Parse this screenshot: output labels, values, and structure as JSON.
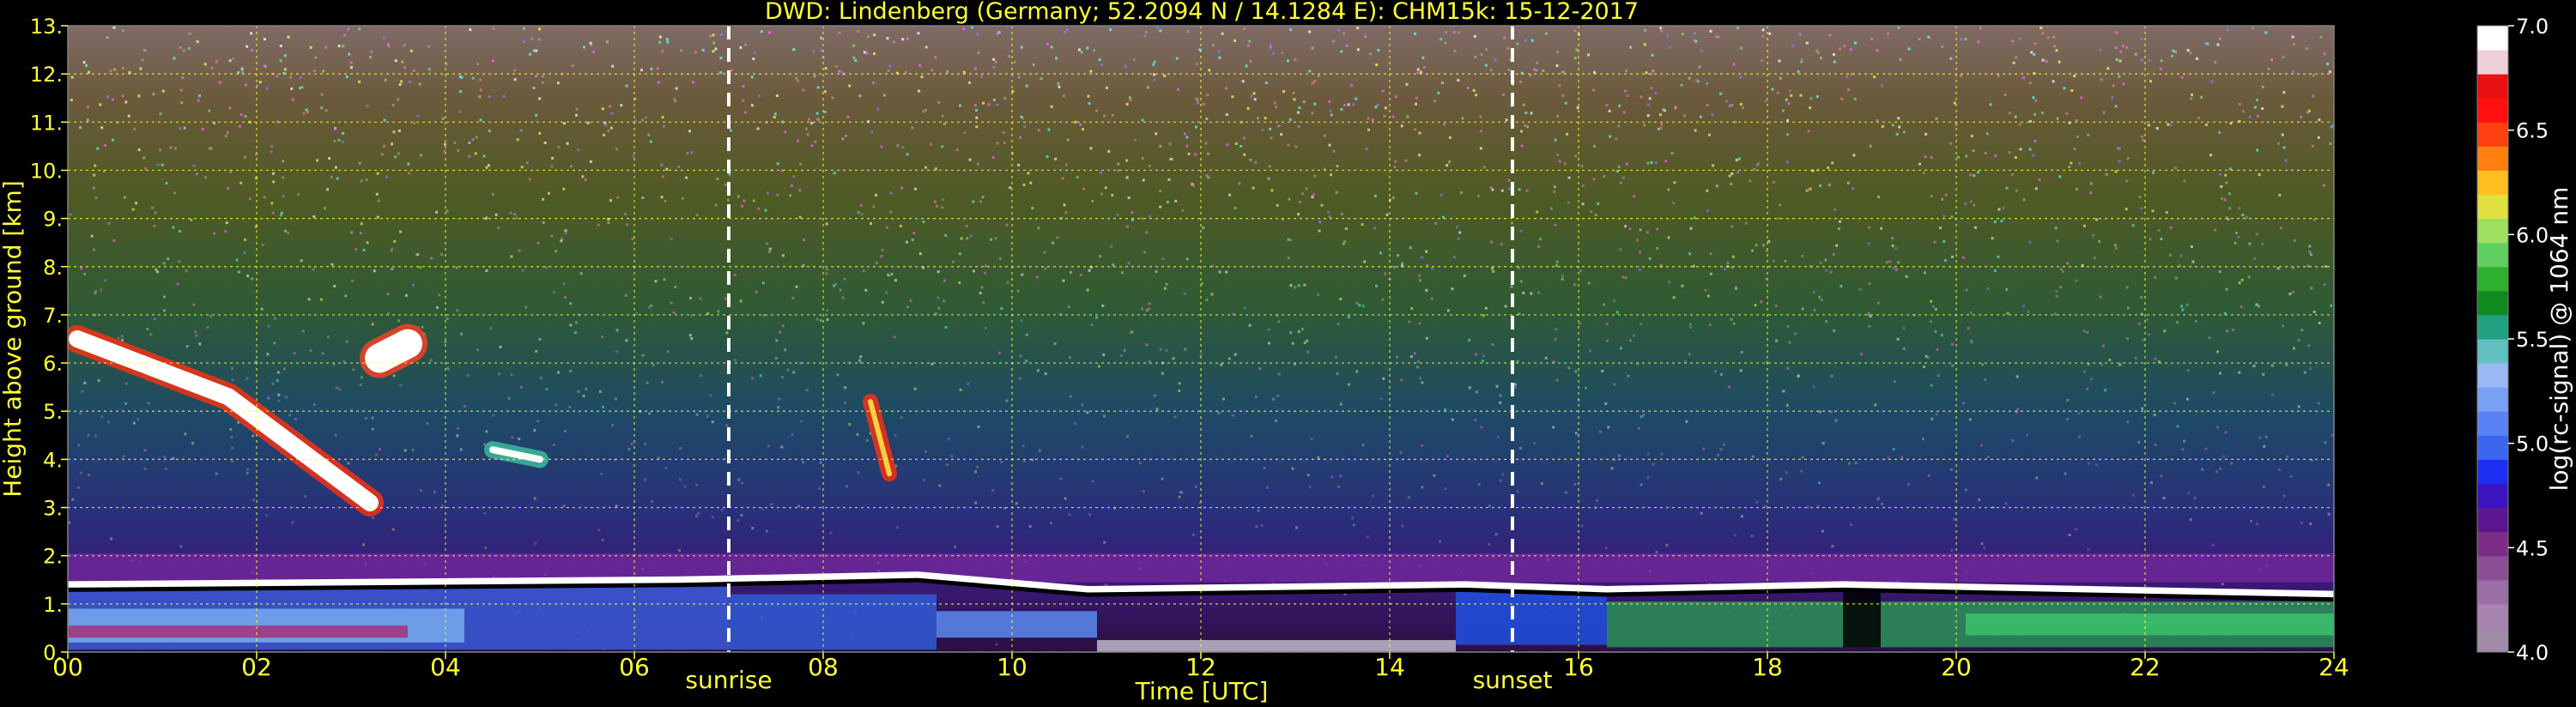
{
  "chart_data": {
    "type": "heatmap",
    "title": "DWD: Lindenberg (Germany; 52.2094 N / 14.1284 E):    CHM15k: 15-12-2017",
    "xlabel": "Time [UTC]",
    "ylabel": "Height above ground [km]",
    "xlim": [
      0,
      24
    ],
    "ylim": [
      0,
      13
    ],
    "x_ticks": [
      "00",
      "02",
      "04",
      "06",
      "08",
      "10",
      "12",
      "14",
      "16",
      "18",
      "20",
      "22",
      "24"
    ],
    "y_ticks": [
      "0.",
      "1.",
      "2.",
      "3.",
      "4.",
      "5.",
      "6.",
      "7.",
      "8.",
      "9.",
      "10.",
      "11.",
      "12.",
      "13."
    ],
    "grid": true,
    "colorbar": {
      "label": "log(rc-signal) @ 1064 nm",
      "range": [
        4.0,
        7.0
      ],
      "ticks": [
        "4.0",
        "4.5",
        "5.0",
        "5.5",
        "6.0",
        "6.5",
        "7.0"
      ],
      "colors": [
        "#a08ca8",
        "#a884b0",
        "#9a6ea6",
        "#8a4f94",
        "#7a2e86",
        "#5e1690",
        "#3a14c0",
        "#1e2ef0",
        "#3a66f0",
        "#5a82f4",
        "#7aa0f4",
        "#9ab8f6",
        "#60c0c0",
        "#20a080",
        "#108a20",
        "#30b030",
        "#60d060",
        "#a0e060",
        "#e0e040",
        "#ffc020",
        "#ff8010",
        "#ff4010",
        "#ff1010",
        "#e81010",
        "#f0d0d8",
        "#ffffff"
      ]
    },
    "markers": [
      {
        "label": "sunrise",
        "x": 7.0
      },
      {
        "label": "sunset",
        "x": 15.3
      }
    ],
    "features": [
      {
        "name": "boundary layer top",
        "points": [
          [
            0,
            1.4
          ],
          [
            6.5,
            1.5
          ],
          [
            9.0,
            1.6
          ],
          [
            10.8,
            1.3
          ],
          [
            14.8,
            1.4
          ],
          [
            16.3,
            1.3
          ],
          [
            18.8,
            1.4
          ],
          [
            24,
            1.2
          ]
        ]
      },
      {
        "name": "fall streaks",
        "points": [
          [
            0.1,
            6.5
          ],
          [
            1.7,
            5.3
          ],
          [
            3.2,
            3.1
          ]
        ]
      },
      {
        "name": "cirrus patch",
        "points": [
          [
            3.3,
            6.1
          ],
          [
            3.6,
            6.4
          ]
        ]
      },
      {
        "name": "mid-level cloud",
        "points": [
          [
            4.5,
            4.2
          ],
          [
            5.0,
            4.0
          ]
        ]
      },
      {
        "name": "virga",
        "points": [
          [
            8.5,
            5.2
          ],
          [
            8.7,
            3.7
          ]
        ]
      }
    ]
  }
}
